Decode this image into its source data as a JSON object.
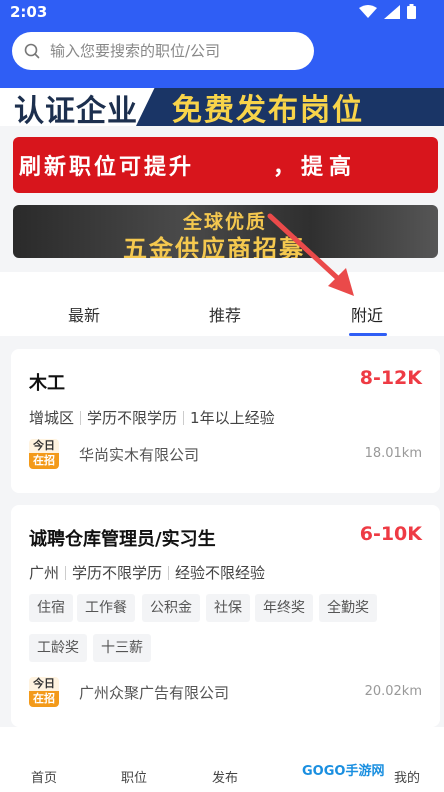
{
  "status_bar": {
    "time": "2:03"
  },
  "search": {
    "placeholder": "输入您要搜索的职位/公司"
  },
  "banners": {
    "banner1_left": "认证企业",
    "banner1_right": "免费发布岗位",
    "banner2_left": "刷新职位可提升",
    "banner2_right": "，提高",
    "banner3_line1": "全球优质",
    "banner3_line2": "五金供应商招募"
  },
  "tabs": [
    {
      "label": "最新"
    },
    {
      "label": "推荐"
    },
    {
      "label": "附近"
    }
  ],
  "active_tab": "附近",
  "jobs": [
    {
      "title": "木工",
      "salary": "8-12K",
      "location": "增城区",
      "education": "学历不限学历",
      "experience": "1年以上经验",
      "badge_top": "今日",
      "badge_bottom": "在招",
      "company": "华尚实木有限公司",
      "distance": "18.01km",
      "tags": []
    },
    {
      "title": "诚聘仓库管理员/实习生",
      "salary": "6-10K",
      "location": "广州",
      "education": "学历不限学历",
      "experience": "经验不限经验",
      "badge_top": "今日",
      "badge_bottom": "在招",
      "company": "广州众聚广告有限公司",
      "distance": "20.02km",
      "tags": [
        "住宿",
        "工作餐",
        "公积金",
        "社保",
        "年终奖",
        "全勤奖",
        "工龄奖",
        "十三薪"
      ]
    }
  ],
  "bottom_nav": [
    {
      "label": "首页"
    },
    {
      "label": "职位"
    },
    {
      "label": "发布"
    },
    {
      "label": "我的"
    }
  ],
  "watermark": "GOGO手游网",
  "colors": {
    "primary": "#2f5ef5",
    "salary": "#ee3b44",
    "badge": "#f39a1a"
  }
}
